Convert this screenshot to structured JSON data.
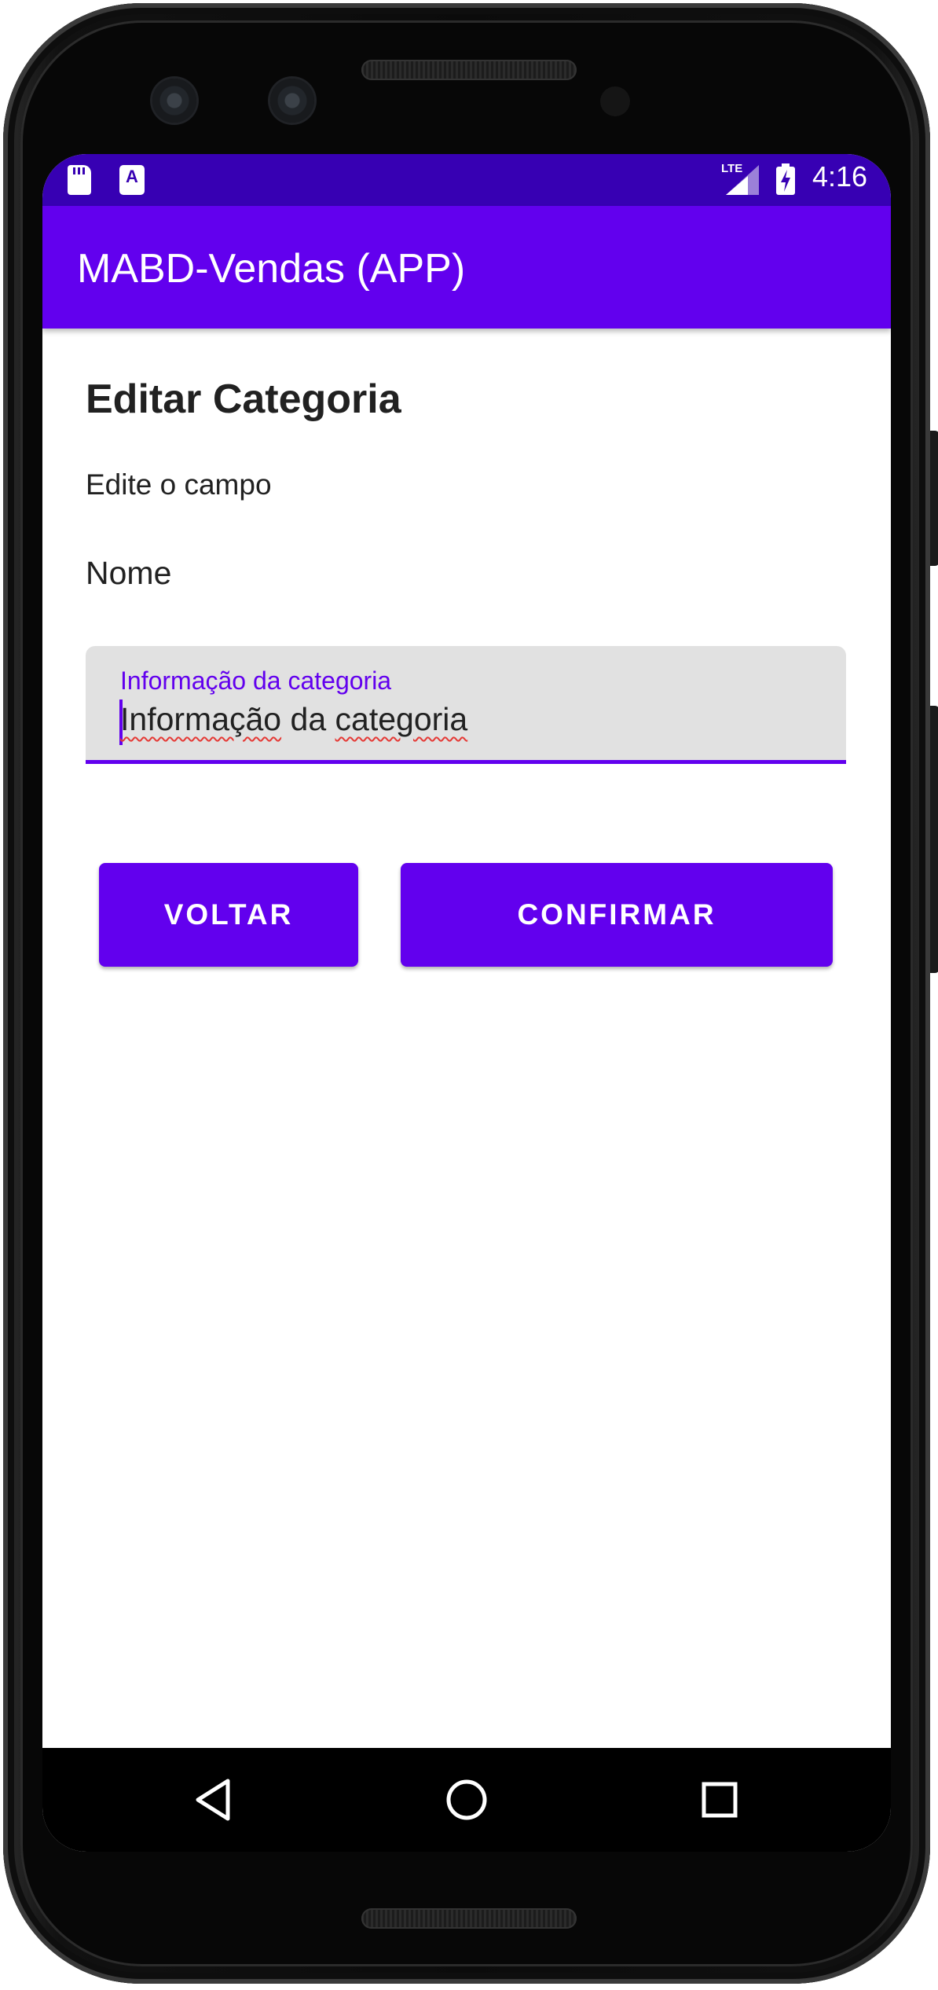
{
  "status_bar": {
    "time": "4:16",
    "network_label": "LTE",
    "icons": [
      "sd-card-icon",
      "a-keyboard-icon",
      "lte-signal-icon",
      "battery-charging-icon"
    ]
  },
  "app_bar": {
    "title": "MABD-Vendas (APP)"
  },
  "form": {
    "title": "Editar Categoria",
    "subtitle": "Edite o campo",
    "field_label": "Nome",
    "input": {
      "label": "Informação da categoria",
      "value_words": [
        "Informação",
        "da",
        "categoria"
      ]
    }
  },
  "buttons": {
    "back_label": "VOLTAR",
    "confirm_label": "CONFIRMAR"
  },
  "nav": {
    "items": [
      "back-icon",
      "home-icon",
      "recents-icon"
    ]
  },
  "colors": {
    "primary": "#6200ee",
    "primary_dark": "#3700b3",
    "text": "#212121",
    "field_bg": "#e1e1e1"
  }
}
